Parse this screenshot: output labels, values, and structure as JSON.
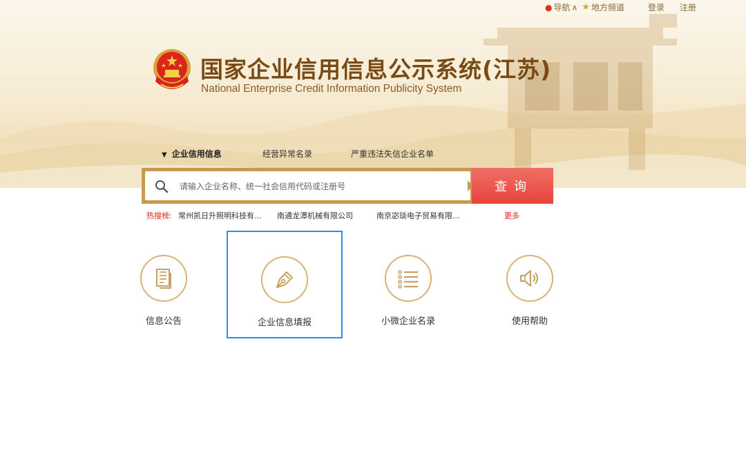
{
  "header": {
    "nav_label": "导航",
    "nav_caret": "∧",
    "local_label": "地方频道",
    "login": "登录",
    "register": "注册"
  },
  "brand": {
    "title_cn": "国家企业信用信息公示系统(江苏)",
    "title_en": "National Enterprise Credit Information Publicity System"
  },
  "tabs": [
    {
      "label": "企业信用信息",
      "active": true
    },
    {
      "label": "经营异常名录",
      "active": false
    },
    {
      "label": "严重违法失信企业名单",
      "active": false
    }
  ],
  "search": {
    "placeholder": "请输入企业名称、统一社会信用代码或注册号",
    "button": "查询"
  },
  "hot": {
    "label": "热搜榜:",
    "items": [
      "常州凯日升照明科技有...",
      "南通龙潭机械有限公司",
      "南京宓琰电子贸易有限..."
    ],
    "more": "更多"
  },
  "cards": [
    {
      "label": "信息公告",
      "icon": "document-icon",
      "selected": false
    },
    {
      "label": "企业信息填报",
      "icon": "pen-nib-icon",
      "selected": true
    },
    {
      "label": "小微企业名录",
      "icon": "list-icon",
      "selected": false
    },
    {
      "label": "使用帮助",
      "icon": "speaker-icon",
      "selected": false
    }
  ],
  "colors": {
    "brand_brown": "#7a4a15",
    "gold": "#c79a52",
    "search_red": "#e5433c",
    "hot_red": "#e3261b",
    "selected_blue": "#2e8ee6"
  }
}
